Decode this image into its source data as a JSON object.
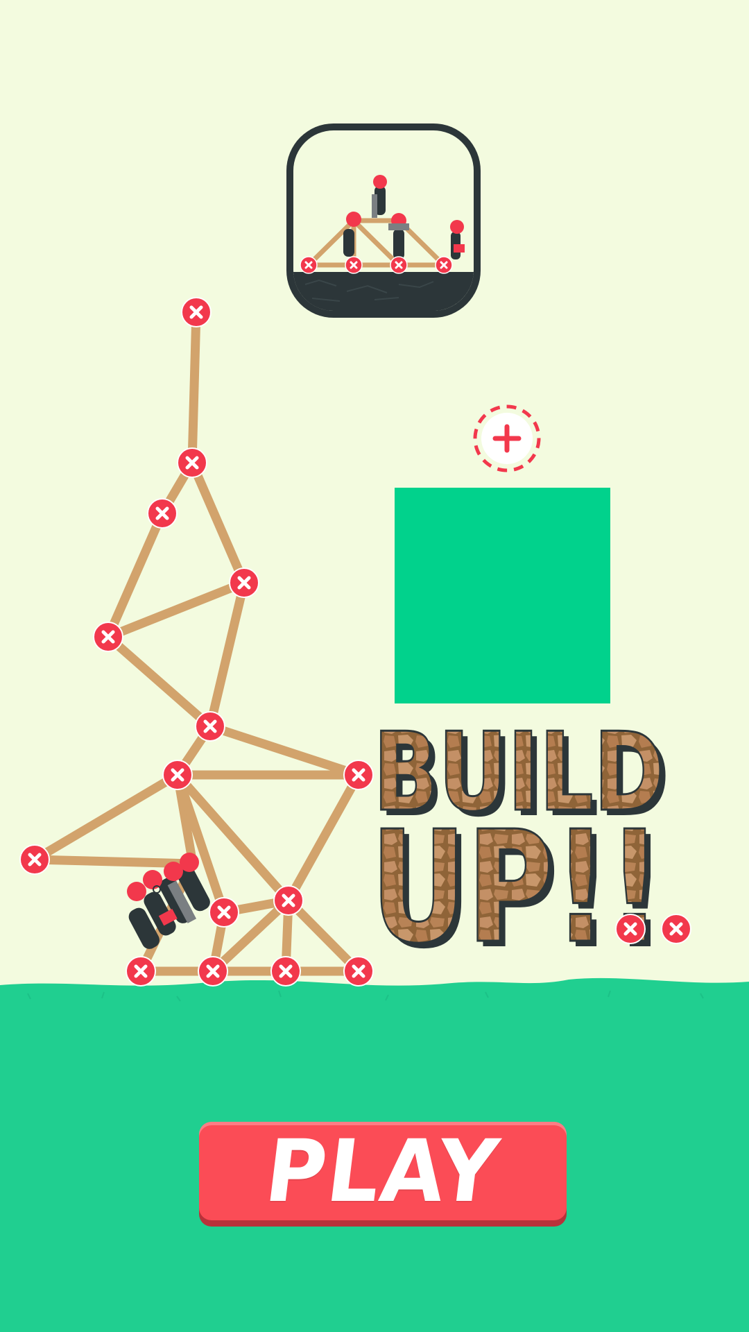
{
  "colors": {
    "background": "#f3fbdf",
    "ground": "#20cf90",
    "green_block": "#01d28c",
    "beam": "#d2a36c",
    "joint": "#f2384c",
    "outline": "#2c3639",
    "button": "#fb4c56"
  },
  "title": {
    "line1": "BUILD",
    "line2": "UP!!"
  },
  "play_button": {
    "label": "PLAY"
  },
  "icons": {
    "app_icon": "bridge-builders-icon",
    "add_node": "plus-icon",
    "joint": "close-icon"
  }
}
